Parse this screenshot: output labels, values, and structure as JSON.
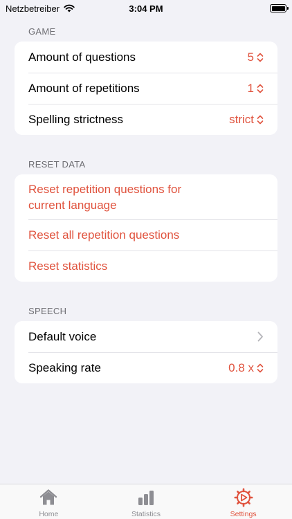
{
  "status_bar": {
    "carrier": "Netzbetreiber",
    "time": "3:04 PM"
  },
  "sections": {
    "game": {
      "header": "GAME",
      "rows": [
        {
          "label": "Amount of questions",
          "value": "5"
        },
        {
          "label": "Amount of repetitions",
          "value": "1"
        },
        {
          "label": "Spelling strictness",
          "value": "strict"
        }
      ]
    },
    "reset": {
      "header": "RESET DATA",
      "rows": [
        {
          "label": "Reset repetition questions for current language"
        },
        {
          "label": "Reset all repetition questions"
        },
        {
          "label": "Reset statistics"
        }
      ]
    },
    "speech": {
      "header": "SPEECH",
      "rows": [
        {
          "label": "Default voice"
        },
        {
          "label": "Speaking rate",
          "value": "0.8 x"
        }
      ]
    }
  },
  "tab_bar": {
    "tabs": [
      {
        "label": "Home",
        "icon": "house-icon",
        "active": false
      },
      {
        "label": "Statistics",
        "icon": "bar-chart-icon",
        "active": false
      },
      {
        "label": "Settings",
        "icon": "gear-icon",
        "active": true
      }
    ]
  },
  "colors": {
    "accent": "#e0533e",
    "background": "#f2f2f7",
    "card": "#ffffff",
    "section_header": "#6e6e73",
    "tab_inactive": "#8e8e93"
  }
}
